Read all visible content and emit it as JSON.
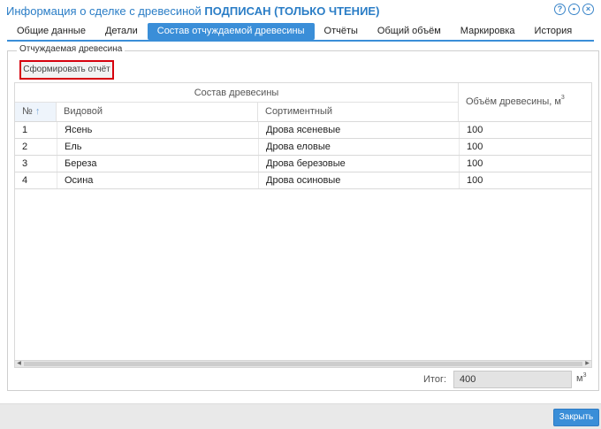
{
  "header": {
    "title_prefix": "Информация о сделке с древесиной ",
    "status": "ПОДПИСАН",
    "mode": " (ТОЛЬКО ЧТЕНИЕ)",
    "icons": [
      "help-icon",
      "settings-icon",
      "close-icon"
    ]
  },
  "tabs": [
    {
      "label": "Общие данные",
      "active": false
    },
    {
      "label": "Детали",
      "active": false
    },
    {
      "label": "Состав отчуждаемой древесины",
      "active": true
    },
    {
      "label": "Отчёты",
      "active": false
    },
    {
      "label": "Общий объём",
      "active": false
    },
    {
      "label": "Маркировка",
      "active": false
    },
    {
      "label": "История",
      "active": false
    }
  ],
  "section": {
    "legend": "Отчуждаемая древесина",
    "report_button": "Сформировать отчёт"
  },
  "grid": {
    "group_header": "Состав древесины",
    "columns": {
      "no": "№",
      "species": "Видовой",
      "assortment": "Сортиментный",
      "volume": "Объём древесины, м",
      "volume_sup": "3"
    },
    "rows": [
      {
        "no": "1",
        "species": "Ясень",
        "assortment": "Дрова ясеневые",
        "volume": "100"
      },
      {
        "no": "2",
        "species": "Ель",
        "assortment": "Дрова еловые",
        "volume": "100"
      },
      {
        "no": "3",
        "species": "Береза",
        "assortment": "Дрова березовые",
        "volume": "100"
      },
      {
        "no": "4",
        "species": "Осина",
        "assortment": "Дрова осиновые",
        "volume": "100"
      }
    ]
  },
  "total": {
    "label": "Итог:",
    "value": "400",
    "unit": "м",
    "unit_sup": "3"
  },
  "footer": {
    "close_button": "Закрыть"
  },
  "colors": {
    "accent": "#3a8ed8",
    "title": "#2a7dc6",
    "highlight": "#d6000d"
  }
}
